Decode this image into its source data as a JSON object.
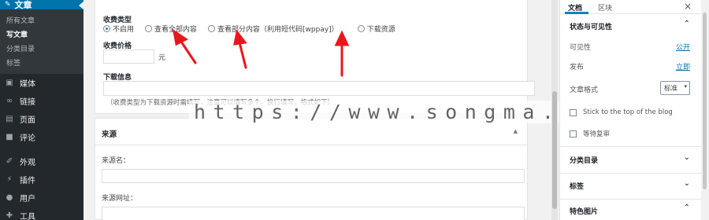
{
  "admin_menu": {
    "current_section": "文章",
    "submenu": [
      "所有文章",
      "写文章",
      "分类目录",
      "标签"
    ],
    "active_submenu": 1,
    "items": [
      {
        "label": "媒体",
        "icon": "media-icon"
      },
      {
        "label": "链接",
        "icon": "link-icon"
      },
      {
        "label": "页面",
        "icon": "page-icon"
      },
      {
        "label": "评论",
        "icon": "comment-icon"
      },
      {
        "label": "外观",
        "icon": "appearance-icon"
      },
      {
        "label": "插件",
        "icon": "plugin-icon"
      },
      {
        "label": "用户",
        "icon": "user-icon"
      },
      {
        "label": "工具",
        "icon": "tools-icon"
      }
    ]
  },
  "download_box": {
    "charge_type_label": "收费类型",
    "radio_options": [
      "不启用",
      "查看全部内容",
      "查看部分内容（利用短代码[wppay]）",
      "下载资源"
    ],
    "selected_option": 0,
    "price_label": "收费价格",
    "price_value": "",
    "price_unit": "元",
    "download_info_label": "下载信息",
    "download_info_value": "",
    "download_info_desc": "（收费类型为下载资源时需填写，注意可以填写多个，换行填写，格式如下）"
  },
  "source_box": {
    "title": "来源",
    "source_name_label": "来源名：",
    "source_url_label": "来源网址："
  },
  "watermark": "https://www.songma.com",
  "settings_panel": {
    "tabs": [
      "文档",
      "区块"
    ],
    "active_tab": 0,
    "status_section_title": "状态与可见性",
    "visibility_label": "可见性",
    "visibility_value": "公开",
    "publish_label": "发布",
    "publish_value": "立即",
    "format_label": "文章格式",
    "format_value": "标准",
    "sticky_label": "Stick to the top of the blog",
    "pending_label": "等待复审",
    "categories_title": "分类目录",
    "tags_title": "标签",
    "featured_image_title": "特色图片"
  },
  "colors": {
    "sidebar_bg": "#23282d",
    "accent_blue": "#0073aa",
    "arrow_red": "#e8171e"
  }
}
